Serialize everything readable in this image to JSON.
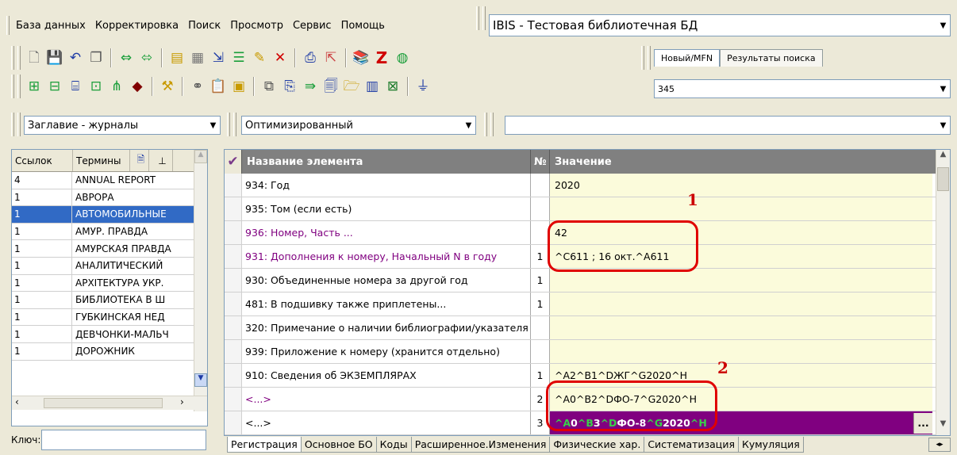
{
  "menu": [
    "База данных",
    "Корректировка",
    "Поиск",
    "Просмотр",
    "Сервис",
    "Помощь"
  ],
  "database_select": "IBIS - Тестовая библиотечная БД",
  "toolbar1_icons": [
    "new-doc-icon",
    "save-icon",
    "undo-icon",
    "copy-icon",
    "prev-next-icon",
    "arrows-icon",
    "template-icon",
    "grid-icon",
    "import-icon",
    "tree-icon",
    "edit-icon",
    "delete-icon",
    "print-icon",
    "export-icon",
    "books-icon",
    "z-icon",
    "globe-icon"
  ],
  "toolbar2_icons": [
    "catalog-icon",
    "catalog2-icon",
    "search-terms-icon",
    "view-icon",
    "tree-icon",
    "stamp-icon",
    "tools-icon",
    "link-icon",
    "paste-icon",
    "clipboard-icon",
    "folder-icon",
    "copy-record-icon",
    "move-record-icon",
    "report-icon",
    "folder-open-icon",
    "chart-icon",
    "excel-icon",
    "filter-icon"
  ],
  "right_tabs": {
    "new_mfn": "Новый/MFN",
    "search_results": "Результаты поиска"
  },
  "mfn_value": "345",
  "dictionary_select": "Заглавие - журналы",
  "worksheet_select": "Оптимизированный",
  "format_select": "",
  "left_panel": {
    "col_links": "Ссылок",
    "col_terms": "Термины",
    "rows": [
      {
        "count": "4",
        "term": "ANNUAL REPORT"
      },
      {
        "count": "1",
        "term": "АВРОРА"
      },
      {
        "count": "1",
        "term": "АВТОМОБИЛЬНЫЕ"
      },
      {
        "count": "1",
        "term": "АМУР. ПРАВДА"
      },
      {
        "count": "1",
        "term": "АМУРСКАЯ ПРАВДА"
      },
      {
        "count": "1",
        "term": "АНАЛИТИЧЕСКИЙ"
      },
      {
        "count": "1",
        "term": "АРХІТЕКТУРА УКР."
      },
      {
        "count": "1",
        "term": "БИБЛИОТЕКА В Ш"
      },
      {
        "count": "1",
        "term": "ГУБКИНСКАЯ НЕД"
      },
      {
        "count": "1",
        "term": "ДЕВЧОНКИ-МАЛЬЧ"
      },
      {
        "count": "1",
        "term": "ДОРОЖНИК"
      }
    ],
    "key_label": "Ключ:",
    "key_value": ""
  },
  "grid": {
    "col_name": "Название элемента",
    "col_no": "№",
    "col_value": "Значение",
    "rows": [
      {
        "name": "934: Год",
        "no": "",
        "value": "2020",
        "purple": false
      },
      {
        "name": "935: Том (если есть)",
        "no": "",
        "value": "",
        "purple": false
      },
      {
        "name": "936: Номер, Часть ...",
        "no": "",
        "value": "42",
        "purple": true
      },
      {
        "name": "931: Дополнения к номеру, Начальный N в году",
        "no": "1",
        "value": "^C611 ; 16 окт.^A611",
        "purple": true
      },
      {
        "name": "930: Объединенные номера за другой год",
        "no": "1",
        "value": "",
        "purple": false
      },
      {
        "name": "481: В подшивку также приплетены...",
        "no": "1",
        "value": "",
        "purple": false
      },
      {
        "name": "320: Примечание о наличии библиографии/указателя",
        "no": "",
        "value": "",
        "purple": false
      },
      {
        "name": "939: Приложение к номеру (хранится отдельно)",
        "no": "",
        "value": "",
        "purple": false
      },
      {
        "name": "910: Сведения  об ЭКЗЕМПЛЯРАХ",
        "no": "1",
        "value": "^A2^B1^DЖГ^G2020^H",
        "purple": false
      },
      {
        "name": "<...>",
        "no": "2",
        "value": "^A0^B2^DФО-7^G2020^H",
        "purple": true
      },
      {
        "name": "<...>",
        "no": "3",
        "value": "^A0^B3^DФО-8^G2020^H",
        "purple": false,
        "selected": true
      }
    ],
    "edit_button": "..."
  },
  "bottom_tabs": [
    "Регистрация",
    "Основное БО",
    "Коды",
    "Расширенное.Изменения",
    "Физические хар.",
    "Систематизация",
    "Кумуляция"
  ],
  "annotations": {
    "marker1": "1",
    "marker2": "2",
    "ring_color": "#e00000"
  }
}
